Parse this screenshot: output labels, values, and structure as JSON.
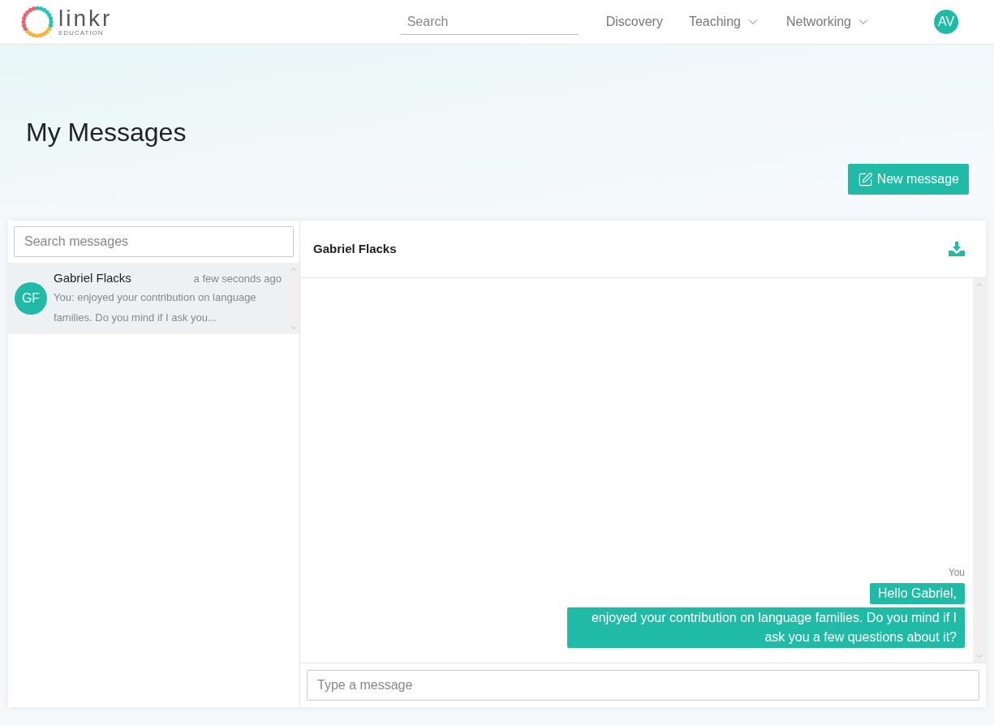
{
  "logo": {
    "name": "linkr",
    "subtitle": "EDUCATION"
  },
  "nav": {
    "search": {
      "placeholder": "Search"
    },
    "items": [
      {
        "label": "Discovery",
        "dropdown": false
      },
      {
        "label": "Teaching",
        "dropdown": true
      },
      {
        "label": "Networking",
        "dropdown": true
      }
    ],
    "avatar": "AV"
  },
  "page": {
    "title": "My Messages",
    "new_button": "New message"
  },
  "sidebar": {
    "search": {
      "placeholder": "Search messages"
    },
    "conversations": [
      {
        "initials": "GF",
        "name": "Gabriel Flacks",
        "time": "a few seconds ago",
        "preview": "You: enjoyed your contribution on language families. Do you mind if I ask you...",
        "selected": true
      }
    ]
  },
  "chat": {
    "title": "Gabriel Flacks",
    "sender": "You",
    "messages": [
      "Hello Gabriel,",
      "enjoyed your contribution on language families. Do you mind if I ask you a few questions about it?"
    ],
    "input": {
      "placeholder": "Type a message"
    }
  }
}
